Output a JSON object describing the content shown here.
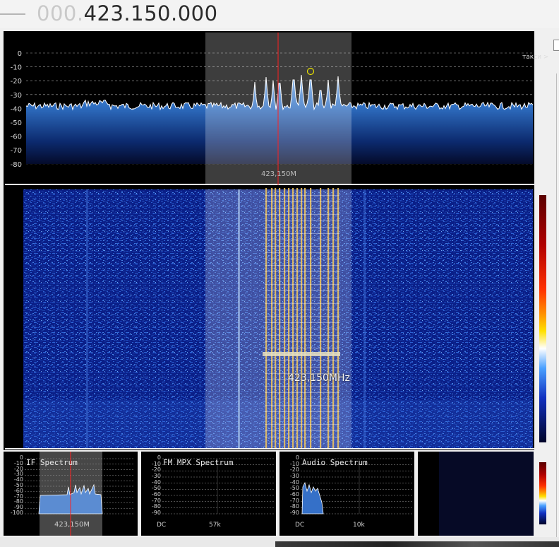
{
  "header": {
    "frequency_prefix": "000.",
    "frequency_main": "423.150.000"
  },
  "spectrum": {
    "db_ticks": [
      "0",
      "-10",
      "-20",
      "-30",
      "-40",
      "-50",
      "-60",
      "-70",
      "-80"
    ],
    "center_label": "423,150M",
    "bookmark_label": "такси >",
    "accent_color": "#ff2020",
    "marker_color": "#e8e000"
  },
  "waterfall": {
    "frequency_label": "423,150MHz",
    "signal_color": "#e8c060"
  },
  "panels": {
    "if_spectrum": {
      "title": "IF Spectrum",
      "db_ticks": [
        "0",
        "-10",
        "-20",
        "-30",
        "-40",
        "-50",
        "-60",
        "-70",
        "-80",
        "-90",
        "-100"
      ],
      "center_label": "423,150M"
    },
    "fm_mpx": {
      "title": "FM MPX Spectrum",
      "db_ticks": [
        "0",
        "-10",
        "-20",
        "-30",
        "-40",
        "-50",
        "-60",
        "-70",
        "-80",
        "-90"
      ],
      "x_left": "DC",
      "x_mid": "57k"
    },
    "audio": {
      "title": "Audio Spectrum",
      "db_ticks": [
        "0",
        "-10",
        "-20",
        "-30",
        "-40",
        "-50",
        "-60",
        "-70",
        "-80",
        "-90"
      ],
      "x_left": "DC",
      "x_mid": "10k"
    }
  }
}
